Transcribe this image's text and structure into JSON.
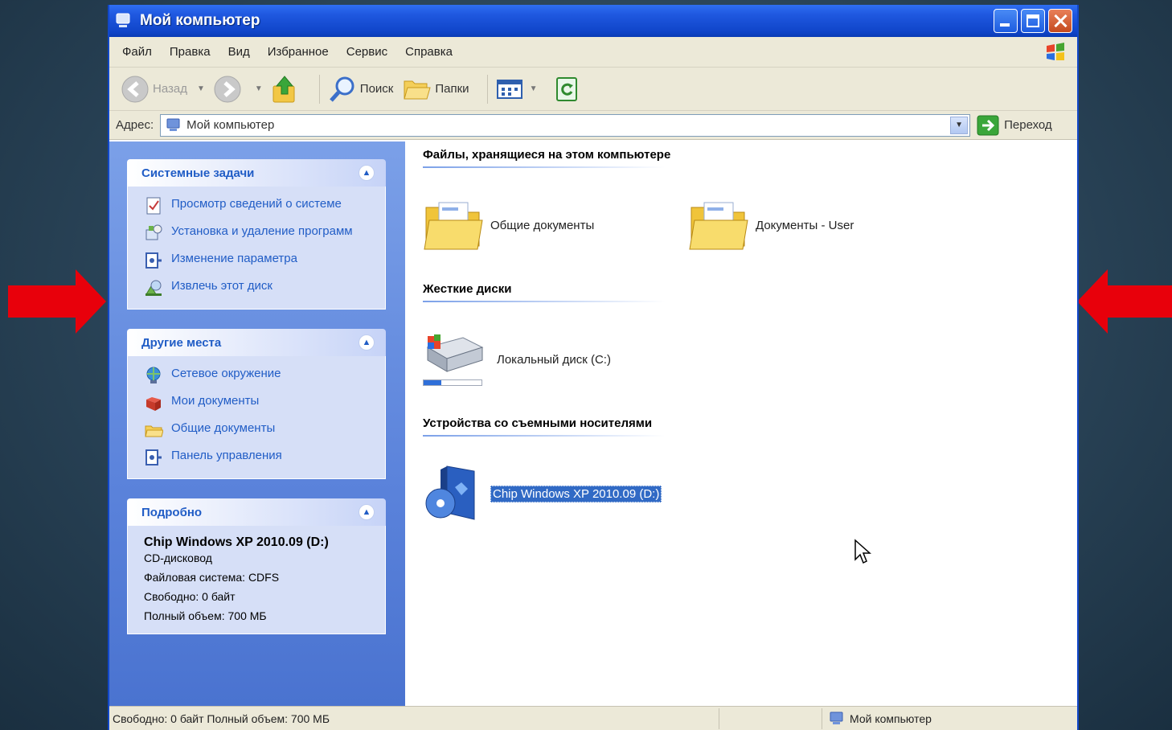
{
  "window": {
    "title": "Мой компьютер"
  },
  "menu": [
    "Файл",
    "Правка",
    "Вид",
    "Избранное",
    "Сервис",
    "Справка"
  ],
  "toolbar": {
    "back": "Назад",
    "search": "Поиск",
    "folders": "Папки"
  },
  "address": {
    "label": "Адрес:",
    "value": "Мой компьютер",
    "go": "Переход"
  },
  "system_tasks": {
    "title": "Системные задачи",
    "items": [
      "Просмотр сведений о системе",
      "Установка и удаление программ",
      "Изменение параметра",
      "Извлечь этот диск"
    ]
  },
  "other_places": {
    "title": "Другие места",
    "items": [
      "Сетевое окружение",
      "Мои документы",
      "Общие документы",
      "Панель управления"
    ]
  },
  "details": {
    "title": "Подробно",
    "name": "Chip Windows XP 2010.09 (D:)",
    "type": "CD-дисковод",
    "fs": "Файловая система: CDFS",
    "free": "Свободно: 0 байт",
    "total": "Полный объем: 700 МБ"
  },
  "groups": {
    "files": {
      "title": "Файлы, хранящиеся на этом компьютере",
      "items": [
        "Общие документы",
        "Документы - User"
      ]
    },
    "drives": {
      "title": "Жесткие диски",
      "items": [
        "Локальный диск (C:)"
      ]
    },
    "removable": {
      "title": "Устройства со съемными носителями",
      "items": [
        "Chip Windows XP 2010.09 (D:)"
      ]
    }
  },
  "drive_c_usage": 0.3,
  "status": {
    "left": "Свободно: 0 байт Полный объем: 700 МБ",
    "right": "Мой компьютер"
  },
  "colors": {
    "arrow": "#e8000b",
    "titlebar": "#0a3bb4",
    "task_link": "#215dc6",
    "selection": "#316ac5"
  }
}
